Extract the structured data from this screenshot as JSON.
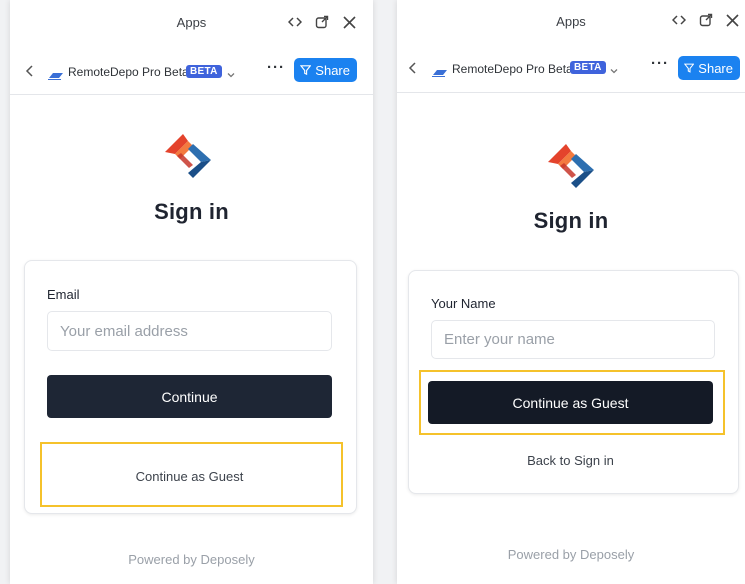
{
  "colors": {
    "accent": "#1b82f0",
    "beta": "#3f63dc",
    "dark_button": "#1e2635",
    "highlight": "#f5c22b"
  },
  "left_panel": {
    "window": {
      "title": "Apps",
      "icons": [
        "code-icon",
        "external-link-icon",
        "close-icon"
      ]
    },
    "toolbar": {
      "app_name": "RemoteDepo Pro Beta",
      "badge": "BETA",
      "more": "···",
      "share_label": "Share"
    },
    "heading": "Sign in",
    "form": {
      "email_label": "Email",
      "email_placeholder": "Your email address",
      "continue_label": "Continue",
      "guest_label": "Continue as Guest"
    },
    "footer": "Powered by Deposely"
  },
  "right_panel": {
    "window": {
      "title": "Apps",
      "icons": [
        "code-icon",
        "external-link-icon",
        "close-icon"
      ]
    },
    "toolbar": {
      "app_name": "RemoteDepo Pro Beta",
      "badge": "BETA",
      "more": "···",
      "share_label": "Share"
    },
    "heading": "Sign in",
    "form": {
      "name_label": "Your Name",
      "name_placeholder": "Enter your name",
      "guest_label": "Continue as Guest",
      "back_label": "Back to Sign in"
    },
    "footer": "Powered by Deposely"
  }
}
